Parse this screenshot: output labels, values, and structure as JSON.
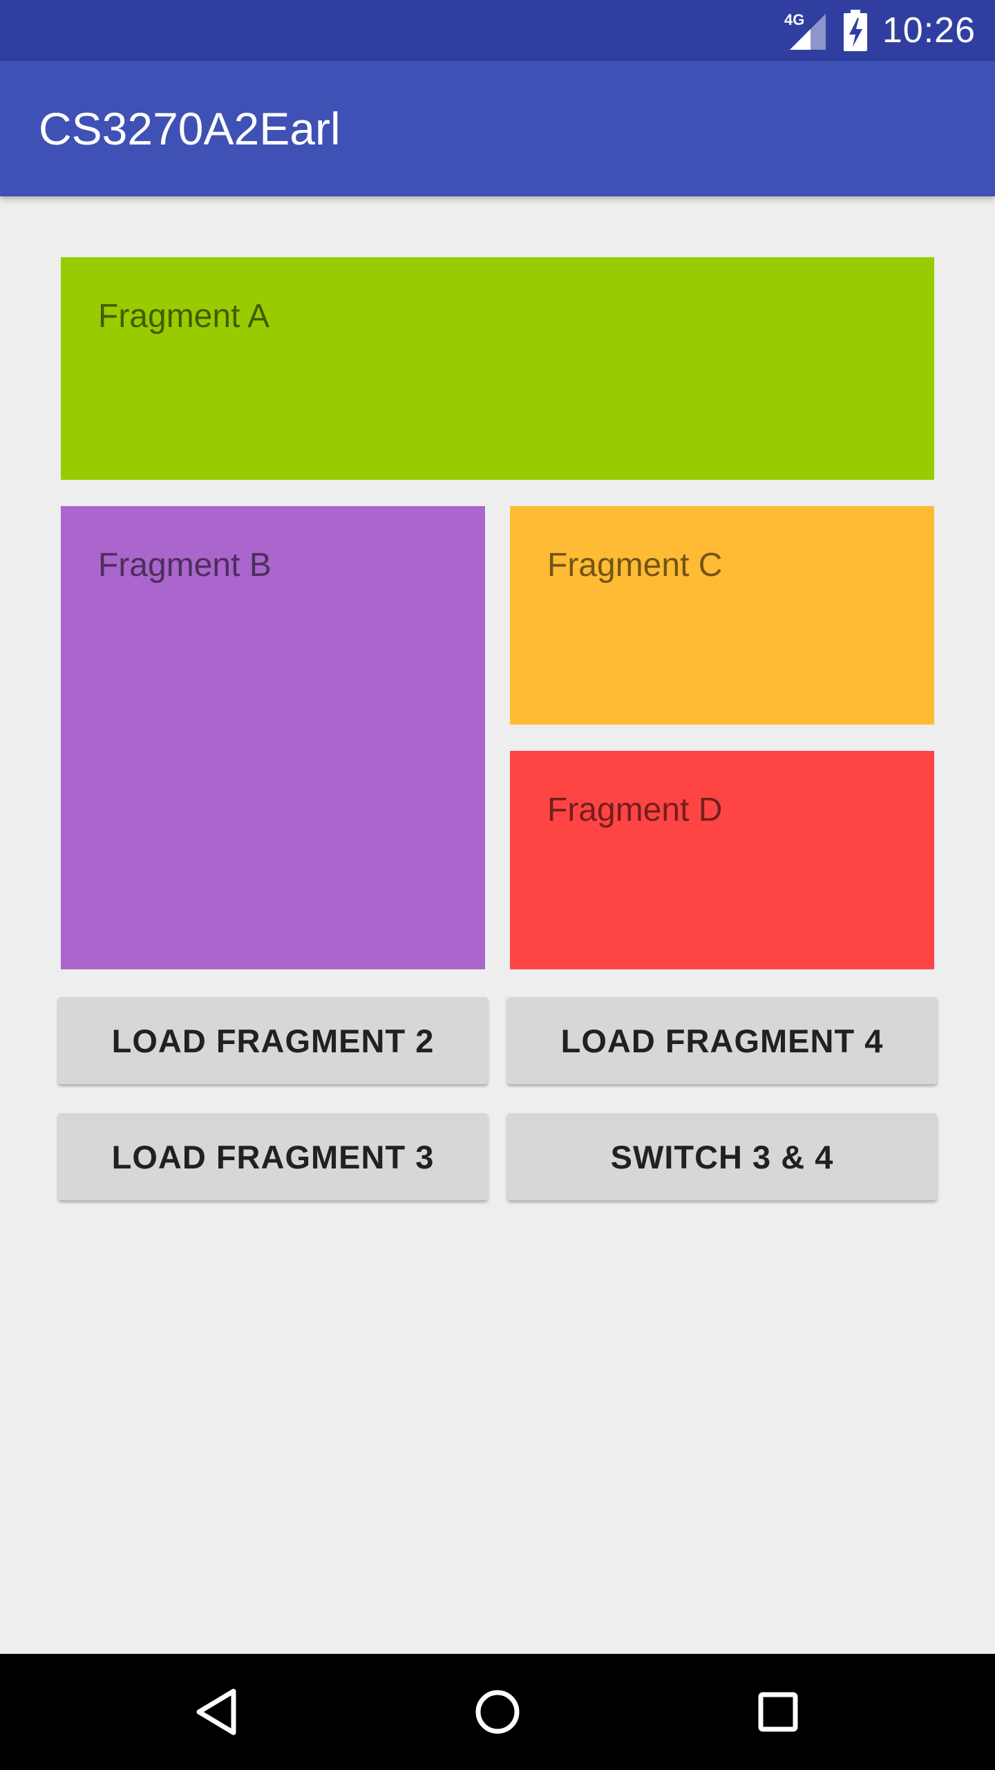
{
  "status_bar": {
    "network": "4G",
    "time": "10:26",
    "icons": [
      "signal-4g-icon",
      "battery-charging-icon"
    ],
    "color": "#303f9f"
  },
  "app_bar": {
    "title": "CS3270A2Earl",
    "color": "#3f51b5"
  },
  "fragments": [
    {
      "label": "Fragment A",
      "color": "#99cc00"
    },
    {
      "label": "Fragment B",
      "color": "#aa66cc"
    },
    {
      "label": "Fragment C",
      "color": "#ffbb33"
    },
    {
      "label": "Fragment D",
      "color": "#ff4444"
    }
  ],
  "buttons": {
    "load_fragment_2": "LOAD FRAGMENT 2",
    "load_fragment_4": "LOAD FRAGMENT 4",
    "load_fragment_3": "LOAD FRAGMENT 3",
    "switch_3_4": "SWITCH 3 & 4"
  },
  "nav_bar": {
    "icons": [
      "back-icon",
      "home-icon",
      "recents-icon"
    ]
  }
}
